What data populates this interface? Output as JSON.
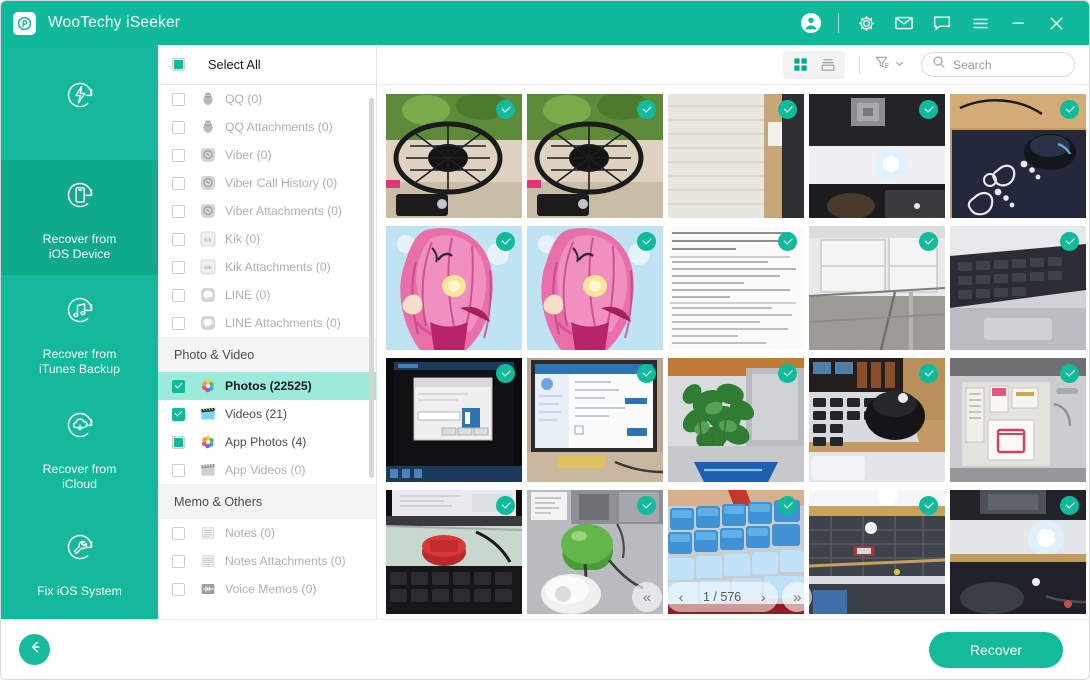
{
  "window": {
    "title": "WooTechy iSeeker",
    "logo_icon": "wootechy-logo-icon",
    "accent_color": "#0fb99a",
    "controls": [
      {
        "name": "account-icon",
        "glyph": "account"
      },
      {
        "name": "gear-icon",
        "glyph": "gear"
      },
      {
        "name": "mail-icon",
        "glyph": "mail"
      },
      {
        "name": "feedback-icon",
        "glyph": "chat"
      },
      {
        "name": "menu-icon",
        "glyph": "hamburger"
      },
      {
        "name": "minimize-icon",
        "glyph": "minimize"
      },
      {
        "name": "close-icon",
        "glyph": "close"
      }
    ]
  },
  "sidebar": {
    "items": [
      {
        "label": "Smart Recovery",
        "icon": "smart-recovery-icon",
        "active": false
      },
      {
        "label": "Recover from\niOS Device",
        "line1": "Recover from",
        "line2": "iOS Device",
        "icon": "ios-device-icon",
        "active": true
      },
      {
        "label": "Recover from\niTunes Backup",
        "line1": "Recover from",
        "line2": "iTunes Backup",
        "icon": "itunes-backup-icon",
        "active": false
      },
      {
        "label": "Recover from\niCloud",
        "line1": "Recover from",
        "line2": "iCloud",
        "icon": "icloud-icon",
        "active": false
      },
      {
        "label": "Fix iOS System",
        "line1": "Fix iOS System",
        "line2": "",
        "icon": "fix-system-icon",
        "active": false
      }
    ]
  },
  "filelist": {
    "select_all_label": "Select All",
    "select_all_state": "partial",
    "rows": [
      {
        "type": "item",
        "label": "QQ (0)",
        "icon": "qq-icon",
        "checked": "none",
        "enabled": false
      },
      {
        "type": "item",
        "label": "QQ Attachments (0)",
        "icon": "qq-icon",
        "checked": "none",
        "enabled": false
      },
      {
        "type": "item",
        "label": "Viber (0)",
        "icon": "viber-icon",
        "checked": "none",
        "enabled": false
      },
      {
        "type": "item",
        "label": "Viber Call History (0)",
        "icon": "viber-icon",
        "checked": "none",
        "enabled": false
      },
      {
        "type": "item",
        "label": "Viber Attachments (0)",
        "icon": "viber-icon",
        "checked": "none",
        "enabled": false
      },
      {
        "type": "item",
        "label": "Kik (0)",
        "icon": "kik-icon",
        "checked": "none",
        "enabled": false
      },
      {
        "type": "item",
        "label": "Kik Attachments (0)",
        "icon": "kik-icon",
        "checked": "none",
        "enabled": false
      },
      {
        "type": "item",
        "label": "LINE (0)",
        "icon": "line-icon",
        "checked": "none",
        "enabled": false
      },
      {
        "type": "item",
        "label": "LINE Attachments (0)",
        "icon": "line-icon",
        "checked": "none",
        "enabled": false
      },
      {
        "type": "group",
        "label": "Photo & Video"
      },
      {
        "type": "item",
        "label": "Photos (22525)",
        "icon": "photos-icon",
        "checked": "checked",
        "enabled": true,
        "selected": true
      },
      {
        "type": "item",
        "label": "Videos (21)",
        "icon": "videos-icon",
        "checked": "checked",
        "enabled": true
      },
      {
        "type": "item",
        "label": "App Photos (4)",
        "icon": "photos-icon",
        "checked": "partial",
        "enabled": true
      },
      {
        "type": "item",
        "label": "App Videos (0)",
        "icon": "videos-icon",
        "checked": "none",
        "enabled": false
      },
      {
        "type": "group",
        "label": "Memo & Others"
      },
      {
        "type": "item",
        "label": "Notes (0)",
        "icon": "notes-icon",
        "checked": "none",
        "enabled": false
      },
      {
        "type": "item",
        "label": "Notes Attachments (0)",
        "icon": "notes-icon",
        "checked": "none",
        "enabled": false
      },
      {
        "type": "item",
        "label": "Voice Memos (0)",
        "icon": "voice-memo-icon",
        "checked": "none",
        "enabled": false
      }
    ]
  },
  "toolbar": {
    "grid_view_icon": "grid-view-icon",
    "list_view_icon": "list-view-icon",
    "active_view": "grid",
    "filter_icon": "filter-icon",
    "search_placeholder": "Search",
    "search_value": "",
    "search_icon": "search-icon"
  },
  "grid": {
    "columns": 5,
    "thumbnails": [
      {
        "name": "thumb-desk-fan-1",
        "checked": true,
        "alt": "black desk fan with plant"
      },
      {
        "name": "thumb-desk-fan-2",
        "checked": true,
        "alt": "black desk fan with plant duplicate"
      },
      {
        "name": "thumb-notebook-paper",
        "checked": true,
        "alt": "blank lined notebook page"
      },
      {
        "name": "thumb-office-light",
        "checked": true,
        "alt": "office ceiling vent and light"
      },
      {
        "name": "thumb-mousepad",
        "checked": true,
        "alt": "mouse on dark mousepad with footprints"
      },
      {
        "name": "thumb-anime-girl-1",
        "checked": true,
        "alt": "pink haired anime character"
      },
      {
        "name": "thumb-anime-girl-2",
        "checked": true,
        "alt": "pink haired anime character duplicate"
      },
      {
        "name": "thumb-text-document",
        "checked": true,
        "alt": "screenshot of dense text document"
      },
      {
        "name": "thumb-office-shelf",
        "checked": true,
        "alt": "white shelving unit in office"
      },
      {
        "name": "thumb-laptop-keyboard",
        "checked": true,
        "alt": "silver laptop keyboard close up"
      },
      {
        "name": "thumb-monitor-dialog",
        "checked": true,
        "alt": "monitor showing small dialog window"
      },
      {
        "name": "thumb-monitor-settings",
        "checked": true,
        "alt": "monitor showing blue settings page"
      },
      {
        "name": "thumb-green-plant",
        "checked": true,
        "alt": "green potted plant on desk"
      },
      {
        "name": "thumb-mouse-laptop",
        "checked": true,
        "alt": "black mouse beside laptop keyboard"
      },
      {
        "name": "thumb-sim-cards",
        "checked": true,
        "alt": "sim cards in plastic tray"
      },
      {
        "name": "thumb-red-device",
        "checked": true,
        "alt": "red round device near keyboard"
      },
      {
        "name": "thumb-green-lamp",
        "checked": true,
        "alt": "green desk lamp"
      },
      {
        "name": "thumb-blue-keyboard",
        "checked": true,
        "alt": "blue mechanical keyboard keys"
      },
      {
        "name": "thumb-ceiling-window",
        "checked": true,
        "alt": "ceiling window frame view"
      },
      {
        "name": "thumb-desk-lamp-glow",
        "checked": true,
        "alt": "bright lamp glow over desk"
      }
    ]
  },
  "pagination": {
    "first_label": "«",
    "prev_label": "‹",
    "next_label": "›",
    "last_label": "»",
    "current_page": 1,
    "total_pages": 576,
    "display": "1 / 576"
  },
  "footer": {
    "back_icon": "back-arrow-icon",
    "recover_label": "Recover"
  }
}
